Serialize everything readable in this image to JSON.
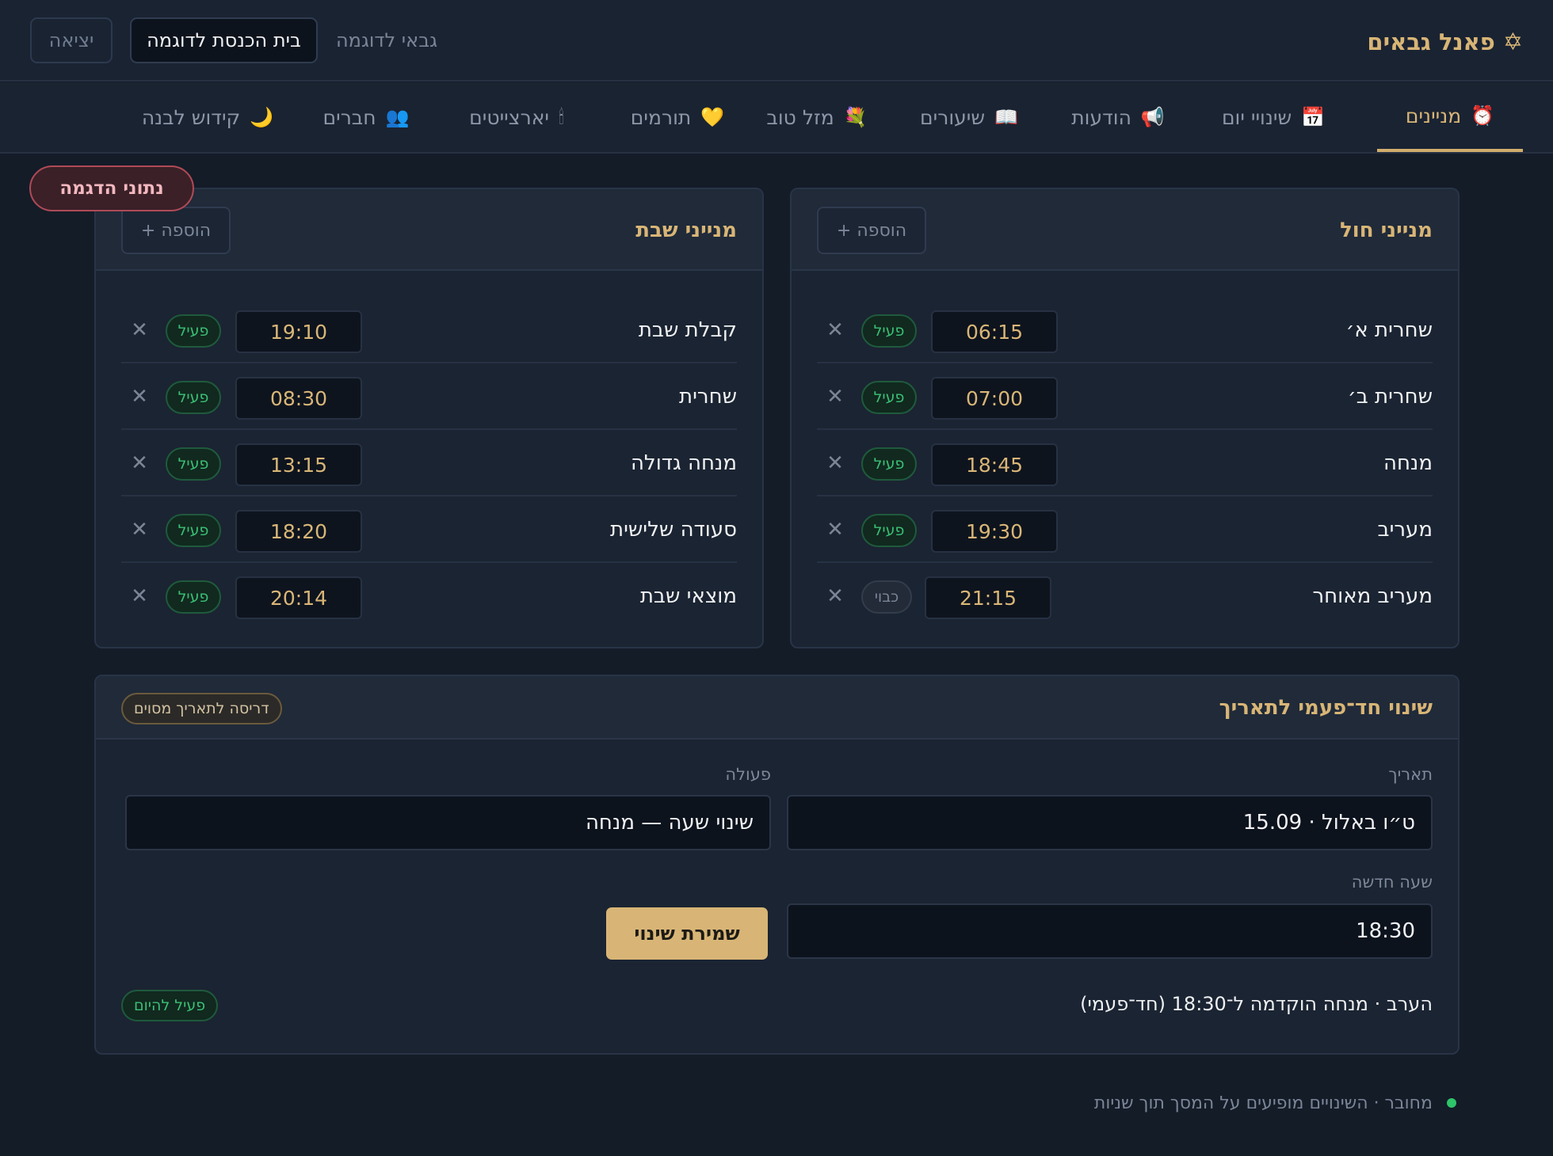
{
  "header": {
    "brand_icon": "✡",
    "brand_title": "פאנל גבאים",
    "user_label": "גבאי לדוגמה",
    "synagogue_label": "בית הכנסת לדוגמה",
    "logout_label": "יציאה"
  },
  "tabs": [
    {
      "label": "מניינים",
      "icon": "alarm-clock-icon",
      "glyph": "⏰",
      "active": true
    },
    {
      "label": "שינויי יום",
      "icon": "calendar-icon",
      "glyph": "📅",
      "active": false
    },
    {
      "label": "הודעות",
      "icon": "megaphone-icon",
      "glyph": "📢",
      "active": false
    },
    {
      "label": "שיעורים",
      "icon": "book-icon",
      "glyph": "📖",
      "active": false
    },
    {
      "label": "מזל טוב",
      "icon": "bouquet-icon",
      "glyph": "💐",
      "active": false
    },
    {
      "label": "תורמים",
      "icon": "heart-icon",
      "glyph": "💛",
      "active": false
    },
    {
      "label": "יארצייטים",
      "icon": "candle-icon",
      "glyph": "🕯",
      "active": false
    },
    {
      "label": "חברים",
      "icon": "people-icon",
      "glyph": "👥",
      "active": false
    },
    {
      "label": "קידוש לבנה",
      "icon": "moon-icon",
      "glyph": "🌙",
      "active": false
    }
  ],
  "demo_badge": "נתוני הדגמה",
  "weekday_card": {
    "title": "מנייני חול",
    "add_label": "+ הוספה",
    "rows": [
      {
        "name": "שחרית א׳",
        "time": "06:15",
        "status": "פעיל",
        "active": true
      },
      {
        "name": "שחרית ב׳",
        "time": "07:00",
        "status": "פעיל",
        "active": true
      },
      {
        "name": "מנחה",
        "time": "18:45",
        "status": "פעיל",
        "active": true
      },
      {
        "name": "מעריב",
        "time": "19:30",
        "status": "פעיל",
        "active": true
      },
      {
        "name": "מעריב מאוחר",
        "time": "21:15",
        "status": "כבוי",
        "active": false
      }
    ]
  },
  "shabbat_card": {
    "title": "מנייני שבת",
    "add_label": "+ הוספה",
    "rows": [
      {
        "name": "קבלת שבת",
        "time": "19:10",
        "status": "פעיל",
        "active": true
      },
      {
        "name": "שחרית",
        "time": "08:30",
        "status": "פעיל",
        "active": true
      },
      {
        "name": "מנחה גדולה",
        "time": "13:15",
        "status": "פעיל",
        "active": true
      },
      {
        "name": "סעודה שלישית",
        "time": "18:20",
        "status": "פעיל",
        "active": true
      },
      {
        "name": "מוצאי שבת",
        "time": "20:14",
        "status": "פעיל",
        "active": true
      }
    ]
  },
  "override_card": {
    "title": "שינוי חד־פעמי לתאריך",
    "tag": "דריסה לתאריך מסוים",
    "date_label": "תאריך",
    "date_value": "ט״ו באלול · 15.09",
    "action_label": "פעולה",
    "action_value": "שינוי שעה — מנחה",
    "new_time_label": "שעה חדשה",
    "new_time_value": "18:30",
    "save_label": "שמירת שינוי",
    "summary": "הערב · מנחה הוקדמה ל־18:30 (חד־פעמי)",
    "today_tag": "פעיל להיום"
  },
  "footer": {
    "status_text": "מחובר · השינויים מופיעים על המסך תוך שניות"
  },
  "colors": {
    "background": "#141c28",
    "accent_gold": "#d8b576",
    "status_green": "#3bbf74",
    "demo_red": "#b04a57"
  }
}
